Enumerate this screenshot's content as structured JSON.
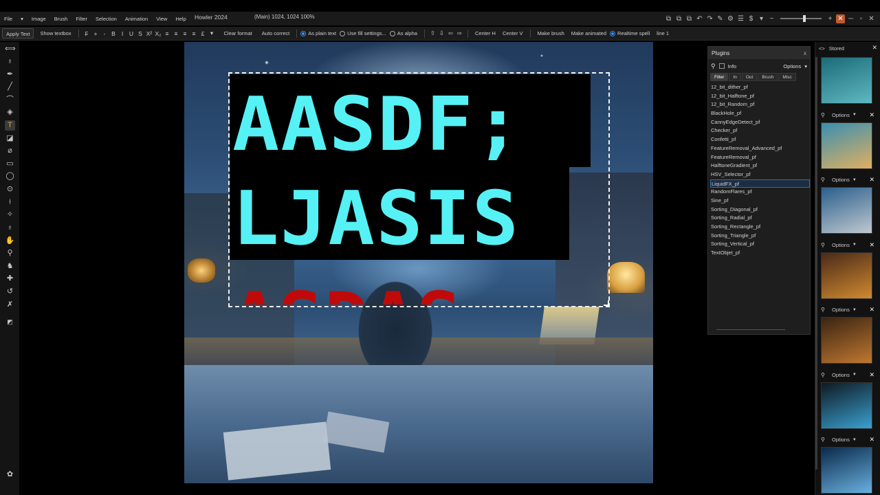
{
  "app": {
    "title": "Howler 2024",
    "doc_info": "(Main)  1024, 1024  100%"
  },
  "menu": [
    "File",
    "Image",
    "Brush",
    "Filter",
    "Selection",
    "Animation",
    "View",
    "Help"
  ],
  "toolbar": {
    "apply_text": "Apply Text",
    "show_textbox": "Show textbox",
    "clear_format": "Clear format",
    "auto_correct": "Auto correct",
    "as_plain_text": "As plain text",
    "use_fill_settings": "Use fill settings...",
    "as_alpha": "As alpha",
    "center_h": "Center H",
    "center_v": "Center V",
    "make_brush": "Make brush",
    "make_animated": "Make animated",
    "realtime_spell": "Realtime spell",
    "line": "line 1",
    "format_glyphs": [
      "B",
      "I",
      "U",
      "S",
      "X²",
      "X₂",
      "≡",
      "≡",
      "≡",
      "≡",
      "£",
      "▾"
    ]
  },
  "canvas": {
    "line1": "AASDF;",
    "line2": "LJASIS",
    "line3": "ASDAS"
  },
  "plugins": {
    "title": "Plugins",
    "close": "x",
    "info_label": "Info",
    "options_label": "Options",
    "tabs": [
      "Filter",
      "In",
      "Out",
      "Brush",
      "Misc"
    ],
    "items": [
      "12_bit_dither_pf",
      "12_bit_Halftone_pf",
      "12_bit_Random_pf",
      "BlackHole_pf",
      "CannyEdgeDetect_pf",
      "Checker_pf",
      "Confetti_pf",
      "FeatureRemoval_Advanced_pf",
      "FeatureRemoval_pf",
      "HalftoneGradient_pf",
      "HSV_Selector_pf",
      "LiquidFX_pf",
      "RandomFlares_pf",
      "Sine_pf",
      "Sorting_Diagonal_pf",
      "Sorting_Radial_pf",
      "Sorting_Rectangle_pf",
      "Sorting_Triangle_pf",
      "Sorting_Vertical_pf",
      "TextObjet_pf"
    ],
    "selected": "LiquidFX_pf"
  },
  "stored": {
    "title": "Stored",
    "options_label": "Options",
    "thumb_colors": [
      [
        "#1c6b7a",
        "#5fb8c0"
      ],
      [
        "#3a8fb0",
        "#e0b060"
      ],
      [
        "#2a5f8c",
        "#c0c8d0"
      ],
      [
        "#4a2a18",
        "#d08a30"
      ],
      [
        "#3a2412",
        "#c07830"
      ],
      [
        "#0e1a22",
        "#3aa0d0"
      ],
      [
        "#0a2a4a",
        "#6ab0e0"
      ]
    ]
  }
}
